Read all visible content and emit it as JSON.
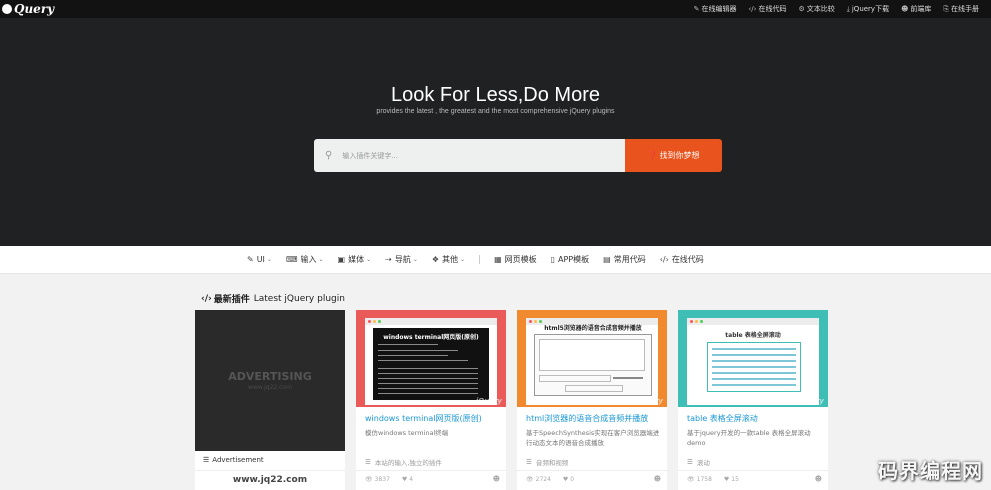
{
  "topbar": {
    "logo": "Query",
    "links": [
      {
        "icon": "edit-icon",
        "glyph": "✎",
        "label": "在线编辑器"
      },
      {
        "icon": "code-icon",
        "glyph": "‹/›",
        "label": "在线代码"
      },
      {
        "icon": "compare-icon",
        "glyph": "⚙",
        "label": "文本比较"
      },
      {
        "icon": "download-icon",
        "glyph": "⤓",
        "label": "jQuery下载"
      },
      {
        "icon": "user-icon",
        "glyph": "☻",
        "label": "前端库"
      },
      {
        "icon": "manual-icon",
        "glyph": "⎘",
        "label": "在线手册"
      }
    ]
  },
  "hero": {
    "title": "Look For Less,Do More",
    "subtitle": "provides the latest , the greatest and the most comprehensive jQuery plugins",
    "search_placeholder": "输入插件关键字...",
    "search_button": "找到你梦想"
  },
  "nav": {
    "items": [
      {
        "icon": "brush-icon",
        "glyph": "✎",
        "label": "UI",
        "dropdown": true
      },
      {
        "icon": "keyboard-icon",
        "glyph": "⌨",
        "label": "输入",
        "dropdown": true
      },
      {
        "icon": "media-icon",
        "glyph": "▣",
        "label": "媒体",
        "dropdown": true
      },
      {
        "icon": "navigation-icon",
        "glyph": "⇢",
        "label": "导航",
        "dropdown": true
      },
      {
        "icon": "dropbox-icon",
        "glyph": "❖",
        "label": "其他",
        "dropdown": true
      },
      {
        "icon": "grid-icon",
        "glyph": "▦",
        "label": "网页模板",
        "dropdown": false
      },
      {
        "icon": "mobile-icon",
        "glyph": "▯",
        "label": "APP模板",
        "dropdown": false
      },
      {
        "icon": "file-icon",
        "glyph": "▤",
        "label": "常用代码",
        "dropdown": false
      },
      {
        "icon": "code-icon",
        "glyph": "‹/›",
        "label": "在线代码",
        "dropdown": false
      }
    ]
  },
  "section": {
    "icon": "‹/›",
    "title_cn": "最新插件",
    "title_en": "Latest jQuery plugin"
  },
  "ad": {
    "text": "ADVERTISING",
    "sub": "www.jq22.com",
    "label": "Advertisement",
    "domain": "www.jq22.com"
  },
  "cards": [
    {
      "title": "windows terminal网页版(原创)",
      "desc": "模仿windows terminal终端",
      "tag": "本站的输入,独立的插件",
      "views": "3837",
      "likes": "4",
      "thumb_heading": "windows terminal网页版(原创)",
      "color": "#ea5a58"
    },
    {
      "title": "html浏览器的语音合成音频并播放",
      "desc": "基于SpeechSynthesis实现在客户浏览器端进行动态文本的语音合成播放",
      "tag": "音频和视频",
      "views": "2724",
      "likes": "0",
      "thumb_heading": "html5浏览器的语音合成音频并播放",
      "color": "#f1892f"
    },
    {
      "title": "table 表格全屏滚动",
      "desc": "基于jquery开发的一款table 表格全屏滚动demo",
      "tag": "滚动",
      "views": "1758",
      "likes": "15",
      "thumb_heading": "table 表格全屏滚动",
      "color": "#3ebeb4"
    }
  ],
  "watermark": "码界编程网",
  "thumb_watermark": "jQuery"
}
